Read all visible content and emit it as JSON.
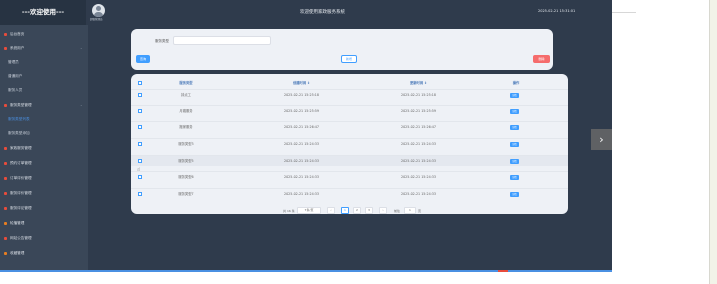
{
  "header": {
    "brand": "---欢迎使用---",
    "username": "超级管理员",
    "system_title": "欢迎使用家政服务系统",
    "datetime": "2025-02-21 15:31:01"
  },
  "sidebar": {
    "items": [
      {
        "label": "后台首页",
        "color": "#e74c3c",
        "arrow": ""
      },
      {
        "label": "系统用户",
        "color": "#e74c3c",
        "arrow": "⌄"
      },
      {
        "label": "管理员",
        "sub": true
      },
      {
        "label": "普通用户",
        "sub": true
      },
      {
        "label": "服务人员",
        "sub": true
      },
      {
        "label": "服务类型管理",
        "color": "#e74c3c",
        "arrow": "⌄"
      },
      {
        "label": "服务类型列表",
        "sub": true,
        "active": true
      },
      {
        "label": "服务类型添加",
        "sub": true
      },
      {
        "label": "家政服务管理",
        "color": "#e74c3c",
        "arrow": ""
      },
      {
        "label": "预约订单管理",
        "color": "#e74c3c",
        "arrow": ""
      },
      {
        "label": "订单评价管理",
        "color": "#e74c3c",
        "arrow": ""
      },
      {
        "label": "服务评价管理",
        "color": "#e74c3c",
        "arrow": ""
      },
      {
        "label": "服务评论管理",
        "color": "#e74c3c",
        "arrow": ""
      },
      {
        "label": "轮播管理",
        "color": "#e67e22",
        "arrow": ""
      },
      {
        "label": "网站公告管理",
        "color": "#e74c3c",
        "arrow": ""
      },
      {
        "label": "收藏管理",
        "color": "#e67e22",
        "arrow": ""
      }
    ]
  },
  "search": {
    "label": "服务类型",
    "value": "",
    "placeholder": "",
    "search_button": "查询",
    "add_button": "新增",
    "delete_button": "删除"
  },
  "table": {
    "columns": [
      "服务类型",
      "创建时间 ↕",
      "更新时间 ↕",
      "操作"
    ],
    "rows": [
      {
        "type": "钟点工",
        "created": "2025-02-21 15:25:18",
        "updated": "2025-02-21 15:25:18",
        "op": "详情"
      },
      {
        "type": "月嫂服务",
        "created": "2025-02-21 15:25:59",
        "updated": "2025-02-21 15:25:59",
        "op": "详情"
      },
      {
        "type": "搬家服务",
        "created": "2025-02-21 15:26:47",
        "updated": "2025-02-21 15:26:47",
        "op": "详情"
      },
      {
        "type": "服务类型3",
        "created": "2025-02-21 15:24:33",
        "updated": "2025-02-21 15:24:33",
        "op": "详情"
      },
      {
        "type": "服务类型5",
        "created": "2025-02-21 15:24:33",
        "updated": "2025-02-21 15:24:33",
        "op": "详情"
      },
      {
        "type": "服务类型6",
        "created": "2025-02-21 15:24:33",
        "updated": "2025-02-21 15:24:33",
        "op": "详情"
      },
      {
        "type": "服务类型7",
        "created": "2025-02-21 15:24:33",
        "updated": "2025-02-21 15:24:33",
        "op": "详情"
      }
    ]
  },
  "pagination": {
    "total": "共 16 条",
    "page_size": "7条/页",
    "prev": "‹",
    "pages": [
      "1",
      "2",
      "3"
    ],
    "next": "›",
    "goto_label": "前往",
    "goto_value": "1",
    "page_suffix": "页"
  },
  "nav": {
    "next_glyph": "›"
  },
  "colors": {
    "accent": "#409eff",
    "danger": "#f56c6c",
    "sidebar": "#3a4758",
    "topbar": "#2f3b4c"
  }
}
